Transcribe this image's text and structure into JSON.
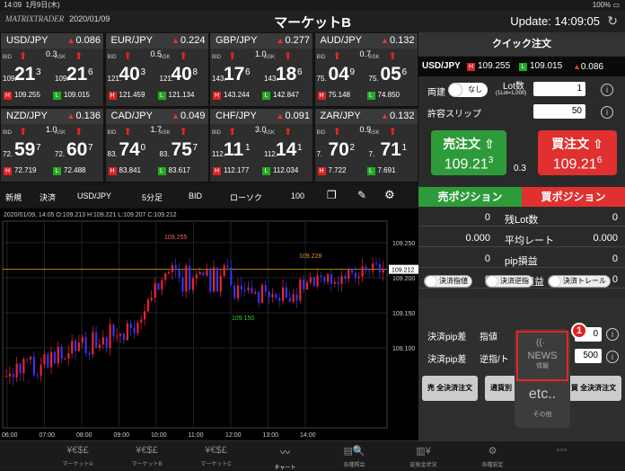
{
  "status": {
    "time": "14:09",
    "date": "1月9日(木)",
    "battery": "100%"
  },
  "header": {
    "logo": "MATRIXTRADER",
    "date": "2020/01/09",
    "title": "マーケットB",
    "update": "Update: 14:09:05"
  },
  "tiles": [
    {
      "pair": "USD/JPY",
      "chg": "0.086",
      "dir": "up",
      "sp": "0.3",
      "bpre": "109.",
      "bbig": "21",
      "bsup": "3",
      "apre": "109.",
      "abig": "21",
      "asup": "6",
      "h": "109.255",
      "l": "109.015"
    },
    {
      "pair": "EUR/JPY",
      "chg": "0.224",
      "dir": "up",
      "sp": "0.5",
      "bpre": "121.",
      "bbig": "40",
      "bsup": "3",
      "apre": "121.",
      "abig": "40",
      "asup": "8",
      "h": "121.459",
      "l": "121.134"
    },
    {
      "pair": "GBP/JPY",
      "chg": "0.277",
      "dir": "up",
      "sp": "1.0",
      "bpre": "143.",
      "bbig": "17",
      "bsup": "6",
      "apre": "143.",
      "abig": "18",
      "asup": "6",
      "h": "143.244",
      "l": "142.847"
    },
    {
      "pair": "AUD/JPY",
      "chg": "0.132",
      "dir": "up",
      "sp": "0.7",
      "bpre": "75.",
      "bbig": "04",
      "bsup": "9",
      "apre": "75.",
      "abig": "05",
      "asup": "6",
      "h": "75.148",
      "l": "74.850"
    },
    {
      "pair": "NZD/JPY",
      "chg": "0.136",
      "dir": "up",
      "sp": "1.0",
      "bpre": "72.",
      "bbig": "59",
      "bsup": "7",
      "apre": "72.",
      "abig": "60",
      "asup": "7",
      "h": "72.719",
      "l": "72.488"
    },
    {
      "pair": "CAD/JPY",
      "chg": "0.049",
      "dir": "up",
      "sp": "1.7",
      "bpre": "83.",
      "bbig": "74",
      "bsup": "0",
      "apre": "83.",
      "abig": "75",
      "asup": "7",
      "h": "83.841",
      "l": "83.617"
    },
    {
      "pair": "CHF/JPY",
      "chg": "0.091",
      "dir": "up",
      "sp": "3.0",
      "bpre": "112.",
      "bbig": "11",
      "bsup": "1",
      "apre": "112.",
      "abig": "14",
      "asup": "1",
      "h": "112.177",
      "l": "112.034"
    },
    {
      "pair": "ZAR/JPY",
      "chg": "0.132",
      "dir": "up",
      "sp": "0.9",
      "bpre": "7.",
      "bbig": "70",
      "bsup": "2",
      "apre": "7.",
      "abig": "71",
      "asup": "1",
      "h": "7.722",
      "l": "7.691"
    }
  ],
  "tile_labels": {
    "bid": "BID",
    "ask": "ASK",
    "h": "H",
    "l": "L"
  },
  "toolbar": {
    "new": "新規",
    "settle": "決済",
    "pair": "USD/JPY",
    "period": "5分足",
    "side": "BID",
    "type": "ローソク",
    "count": "100"
  },
  "chart_info": "2020/01/09, 14:05 O:109.213 H:109.221 L:109.207 C:109.212",
  "chart_data": {
    "type": "candlestick",
    "ylabels": [
      "109.250",
      "109.200",
      "109.150",
      "109.100"
    ],
    "xlabels": [
      "06:00",
      "07:00",
      "08:00",
      "09:00",
      "10:00",
      "11:00",
      "12:00",
      "13:00",
      "14:00"
    ],
    "current": "109.212",
    "high_label": "109.255",
    "low_label": "109.150",
    "recent_high": "109.228"
  },
  "quick": {
    "title": "クイック注文",
    "pair": "USD/JPY",
    "h": "109.255",
    "l": "109.015",
    "chg": "0.086",
    "ryoudate": "両建",
    "toggle": "なし",
    "lot_label": "Lot数",
    "lot_sub": "(1Lot=1,000)",
    "lot": "1",
    "slip_label": "許容スリップ",
    "slip": "50",
    "sell_label": "売注文",
    "sell_pre": "109.21",
    "sell_sup": "3",
    "spread": "0.3",
    "buy_label": "買注文",
    "buy_pre": "109.21",
    "buy_sup": "6",
    "sell_pos": "売ポジション",
    "buy_pos": "買ポジション",
    "rows": [
      {
        "k": "残Lot数",
        "v": "0",
        "v2": "0"
      },
      {
        "k": "平均レート",
        "v": "0.000",
        "v2": "0.000"
      },
      {
        "k": "pip損益",
        "v": "0",
        "v2": "0"
      },
      {
        "k": "評価損益",
        "v": "0",
        "v2": "0"
      }
    ],
    "r1": "決済指値",
    "r2": "決済逆指",
    "r3": "決済トレール",
    "pip1": "決済pip差",
    "pip1b": "指値",
    "pip1v": "0",
    "pip2": "決済pip差",
    "pip2b": "逆指/ト",
    "pip2v": "500",
    "b1": "売 全決済注文",
    "b2": "通貨別",
    "b3": "買 全決済注文"
  },
  "popup": {
    "news": "NEWS",
    "news_sub": "情報",
    "etc": "etc..",
    "etc_sub": "その他",
    "badge": "1"
  },
  "tabs": [
    {
      "i": "¥€$£",
      "l": "マーケットA"
    },
    {
      "i": "¥€$£",
      "l": "マーケットB"
    },
    {
      "i": "¥€$£",
      "l": "マーケットC"
    },
    {
      "i": "〰",
      "l": "チャート"
    },
    {
      "i": "▤🔍",
      "l": "各種照会"
    },
    {
      "i": "▥¥",
      "l": "証拠金状況"
    },
    {
      "i": "⚙",
      "l": "各種設定"
    },
    {
      "i": "◦◦◦",
      "l": ""
    }
  ]
}
